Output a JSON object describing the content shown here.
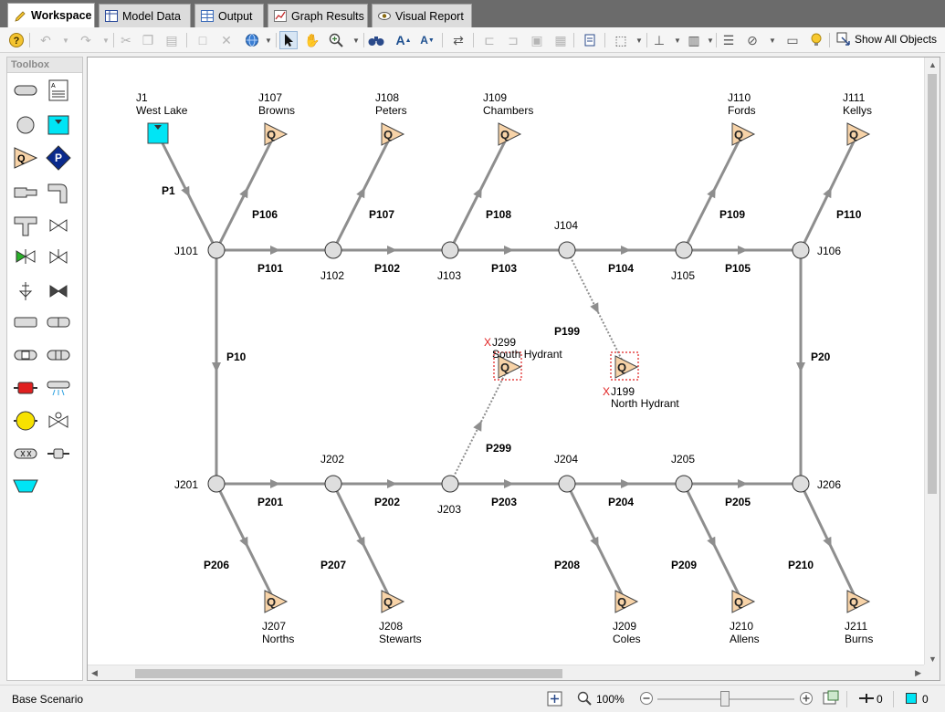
{
  "tabs": [
    {
      "label": "Workspace",
      "icon": "pencil-icon"
    },
    {
      "label": "Model Data",
      "icon": "table-icon"
    },
    {
      "label": "Output",
      "icon": "grid-icon"
    },
    {
      "label": "Graph Results",
      "icon": "graph-icon"
    },
    {
      "label": "Visual Report",
      "icon": "eye-icon"
    }
  ],
  "toolbar": {
    "show_all_label": "Show All Objects"
  },
  "toolbox": {
    "title": "Toolbox"
  },
  "network": {
    "junctions": [
      {
        "id": "J1",
        "name": "West Lake",
        "kind": "reservoir"
      },
      {
        "id": "J107",
        "name": "Browns",
        "kind": "assigned-flow"
      },
      {
        "id": "J108",
        "name": "Peters",
        "kind": "assigned-flow"
      },
      {
        "id": "J109",
        "name": "Chambers",
        "kind": "assigned-flow"
      },
      {
        "id": "J110",
        "name": "Fords",
        "kind": "assigned-flow"
      },
      {
        "id": "J111",
        "name": "Kellys",
        "kind": "assigned-flow"
      },
      {
        "id": "J101",
        "name": "",
        "kind": "branch"
      },
      {
        "id": "J102",
        "name": "",
        "kind": "branch"
      },
      {
        "id": "J103",
        "name": "",
        "kind": "branch"
      },
      {
        "id": "J104",
        "name": "",
        "kind": "branch"
      },
      {
        "id": "J105",
        "name": "",
        "kind": "branch"
      },
      {
        "id": "J106",
        "name": "",
        "kind": "branch"
      },
      {
        "id": "J299",
        "name": "South Hydrant",
        "kind": "assigned-flow-closed"
      },
      {
        "id": "J199",
        "name": "North Hydrant",
        "kind": "assigned-flow-closed"
      },
      {
        "id": "J201",
        "name": "",
        "kind": "branch"
      },
      {
        "id": "J202",
        "name": "",
        "kind": "branch"
      },
      {
        "id": "J203",
        "name": "",
        "kind": "branch"
      },
      {
        "id": "J204",
        "name": "",
        "kind": "branch"
      },
      {
        "id": "J205",
        "name": "",
        "kind": "branch"
      },
      {
        "id": "J206",
        "name": "",
        "kind": "branch"
      },
      {
        "id": "J207",
        "name": "Norths",
        "kind": "assigned-flow"
      },
      {
        "id": "J208",
        "name": "Stewarts",
        "kind": "assigned-flow"
      },
      {
        "id": "J209",
        "name": "Coles",
        "kind": "assigned-flow"
      },
      {
        "id": "J210",
        "name": "Allens",
        "kind": "assigned-flow"
      },
      {
        "id": "J211",
        "name": "Burns",
        "kind": "assigned-flow"
      }
    ],
    "pipes": [
      {
        "id": "P1",
        "from": "J1",
        "to": "J101",
        "closed": false
      },
      {
        "id": "P106",
        "from": "J101",
        "to": "J107",
        "closed": false
      },
      {
        "id": "P107",
        "from": "J102",
        "to": "J108",
        "closed": false
      },
      {
        "id": "P108",
        "from": "J103",
        "to": "J109",
        "closed": false
      },
      {
        "id": "P109",
        "from": "J105",
        "to": "J110",
        "closed": false
      },
      {
        "id": "P110",
        "from": "J106",
        "to": "J111",
        "closed": false
      },
      {
        "id": "P101",
        "from": "J101",
        "to": "J102",
        "closed": false
      },
      {
        "id": "P102",
        "from": "J102",
        "to": "J103",
        "closed": false
      },
      {
        "id": "P103",
        "from": "J103",
        "to": "J104",
        "closed": false
      },
      {
        "id": "P104",
        "from": "J104",
        "to": "J105",
        "closed": false
      },
      {
        "id": "P105",
        "from": "J105",
        "to": "J106",
        "closed": false
      },
      {
        "id": "P10",
        "from": "J101",
        "to": "J201",
        "closed": false
      },
      {
        "id": "P20",
        "from": "J106",
        "to": "J206",
        "closed": false
      },
      {
        "id": "P199",
        "from": "J104",
        "to": "J199",
        "closed": true
      },
      {
        "id": "P299",
        "from": "J203",
        "to": "J299",
        "closed": true
      },
      {
        "id": "P201",
        "from": "J201",
        "to": "J202",
        "closed": false
      },
      {
        "id": "P202",
        "from": "J202",
        "to": "J203",
        "closed": false
      },
      {
        "id": "P203",
        "from": "J203",
        "to": "J204",
        "closed": false
      },
      {
        "id": "P204",
        "from": "J204",
        "to": "J205",
        "closed": false
      },
      {
        "id": "P205",
        "from": "J205",
        "to": "J206",
        "closed": false
      },
      {
        "id": "P206",
        "from": "J201",
        "to": "J207",
        "closed": false
      },
      {
        "id": "P207",
        "from": "J202",
        "to": "J208",
        "closed": false
      },
      {
        "id": "P208",
        "from": "J204",
        "to": "J209",
        "closed": false
      },
      {
        "id": "P209",
        "from": "J205",
        "to": "J210",
        "closed": false
      },
      {
        "id": "P210",
        "from": "J206",
        "to": "J211",
        "closed": false
      }
    ],
    "flow_symbol": "Q",
    "closed_marker": "X"
  },
  "statusbar": {
    "scenario": "Base Scenario",
    "zoom": "100%",
    "pipe_count": "0",
    "junction_count": "0"
  },
  "colors": {
    "pipe": "#8e8e8e",
    "reservoir": "#00e5f5",
    "flow_fill": "#f7d3a8",
    "closed_marker": "#e02020",
    "pump_blue": "#0a2a8c"
  }
}
